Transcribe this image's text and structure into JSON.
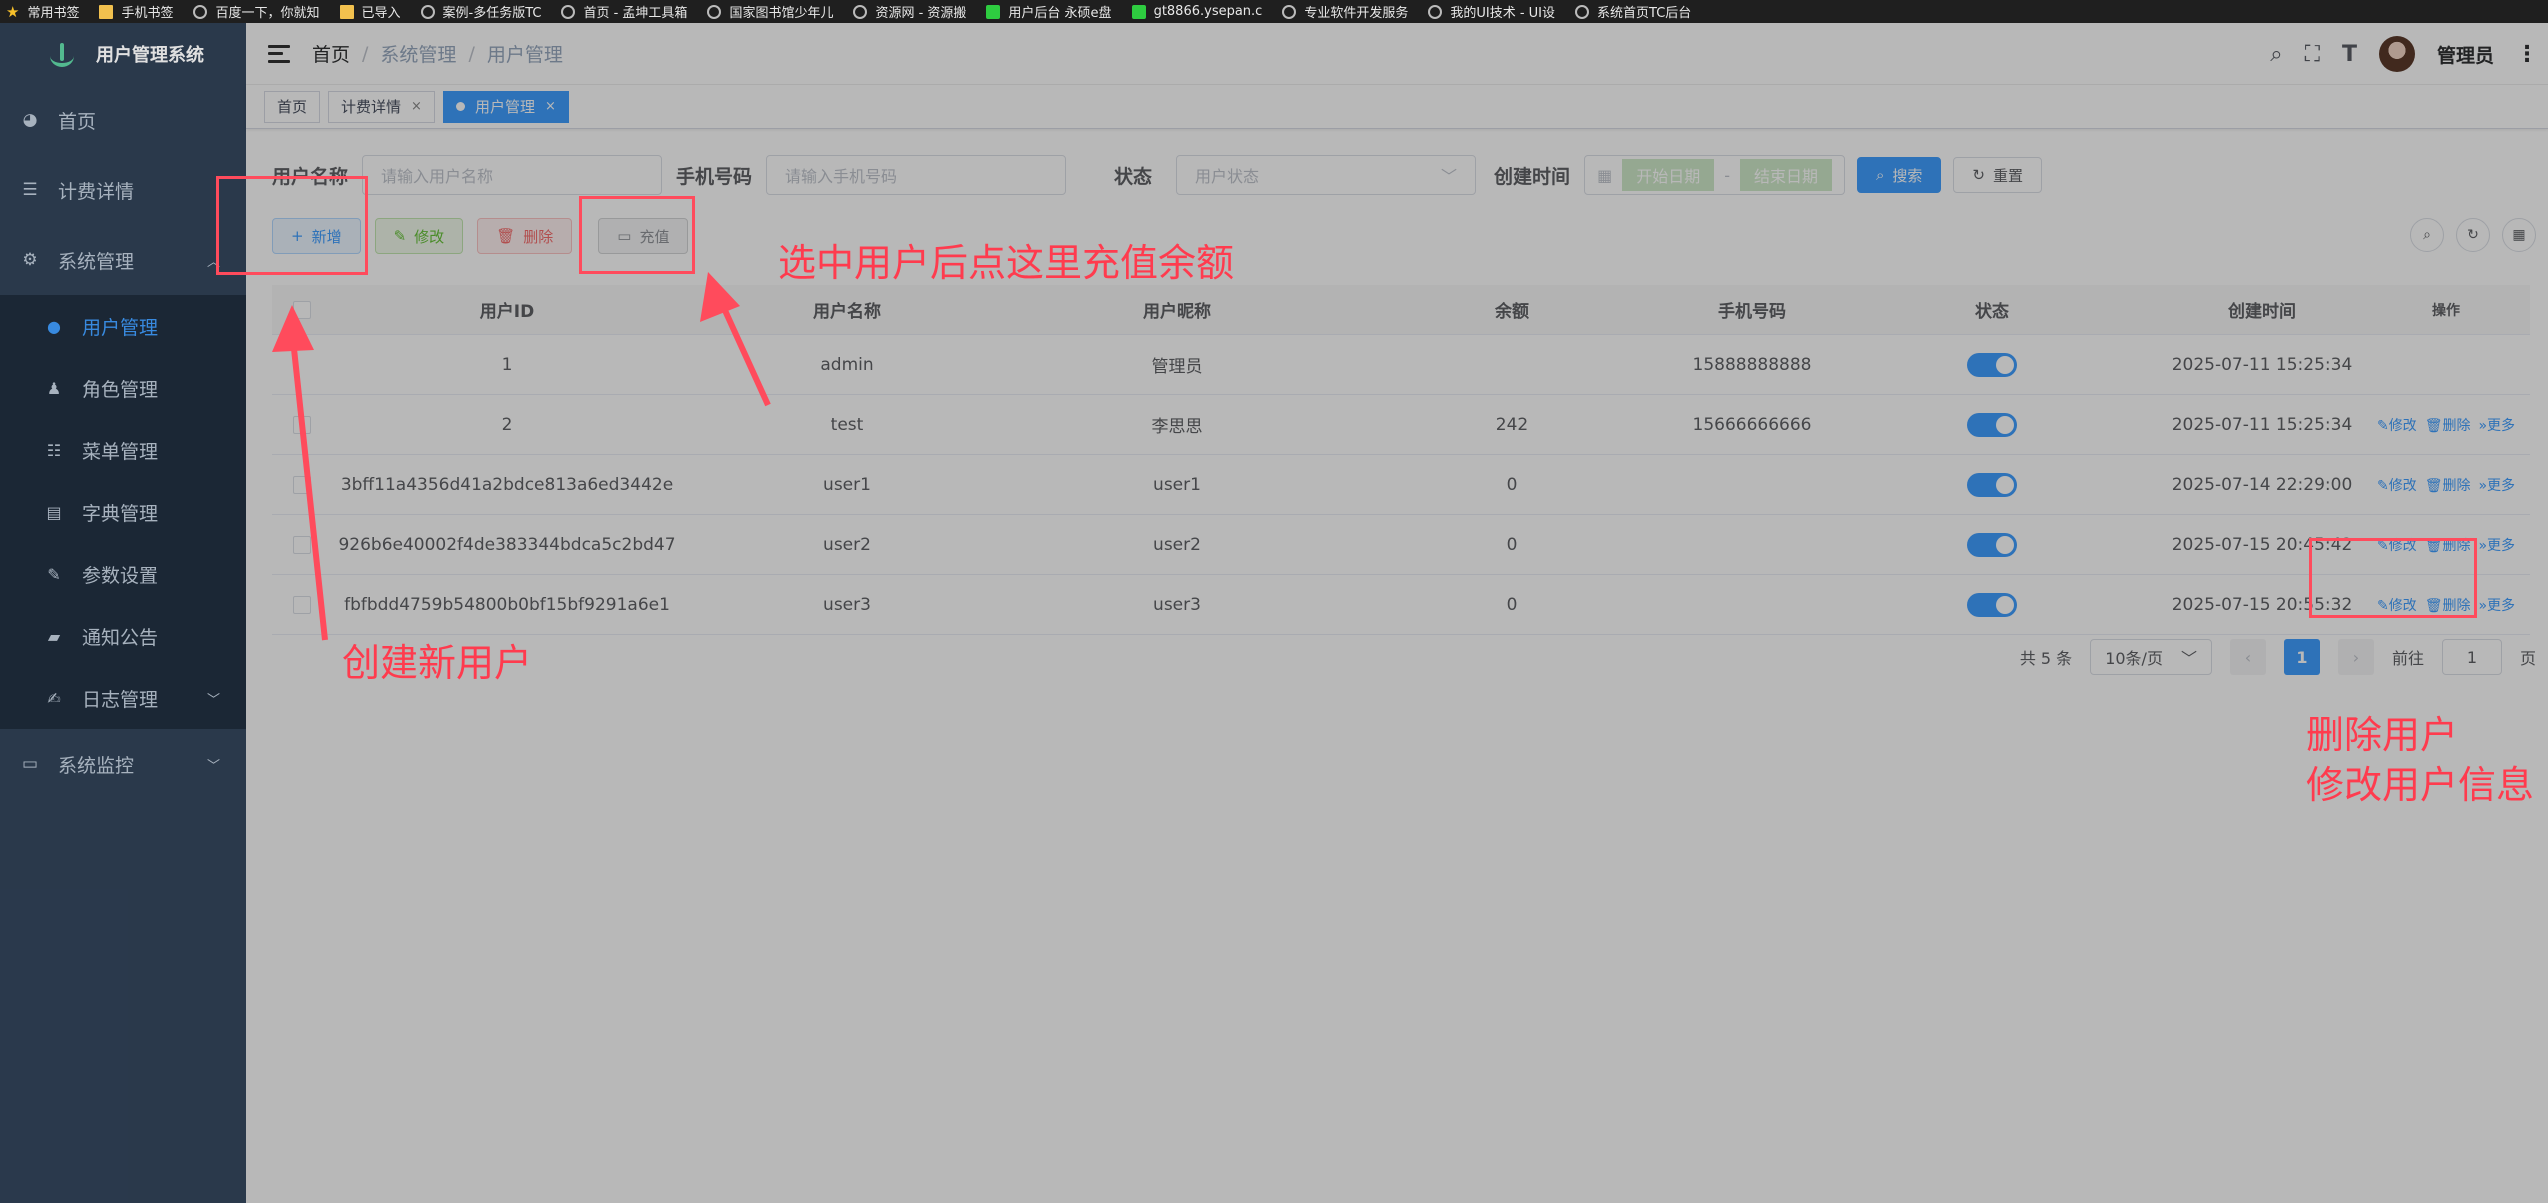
{
  "bookmarks": [
    "常用书签",
    "手机书签",
    "百度一下，你就知",
    "已导入",
    "案例-多任务版TC",
    "首页 - 孟坤工具箱",
    "国家图书馆少年儿",
    "资源网 - 资源搬",
    "用户后台 永硕e盘",
    "gt8866.ysepan.c",
    "专业软件开发服务",
    "我的UI技术 - UI设",
    "系统首页TC后台"
  ],
  "app_title": "用户管理系统",
  "sidebar": {
    "items": [
      {
        "label": "首页"
      },
      {
        "label": "计费详情"
      },
      {
        "label": "系统管理"
      },
      {
        "label": "系统监控"
      }
    ],
    "submenu": [
      {
        "label": "用户管理"
      },
      {
        "label": "角色管理"
      },
      {
        "label": "菜单管理"
      },
      {
        "label": "字典管理"
      },
      {
        "label": "参数设置"
      },
      {
        "label": "通知公告"
      },
      {
        "label": "日志管理"
      }
    ]
  },
  "breadcrumb": [
    "首页",
    "系统管理",
    "用户管理"
  ],
  "navbar": {
    "user_name": "管理员"
  },
  "tabs": [
    {
      "label": "首页"
    },
    {
      "label": "计费详情",
      "close": "×"
    },
    {
      "label": "用户管理",
      "close": "×"
    }
  ],
  "search": {
    "username_label": "用户名称",
    "username_placeholder": "请输入用户名称",
    "phone_label": "手机号码",
    "phone_placeholder": "请输入手机号码",
    "status_label": "状态",
    "status_placeholder": "用户状态",
    "created_label": "创建时间",
    "start_placeholder": "开始日期",
    "range_sep": "-",
    "end_placeholder": "结束日期",
    "search_btn": "搜索",
    "reset_btn": "重置"
  },
  "toolbar": {
    "add": "新增",
    "edit": "修改",
    "delete": "删除",
    "recharge": "充值"
  },
  "table": {
    "headers": [
      "用户ID",
      "用户名称",
      "用户昵称",
      "余额",
      "手机号码",
      "状态",
      "创建时间",
      "操作"
    ],
    "rows": [
      {
        "id": "1",
        "name": "admin",
        "nick": "管理员",
        "balance": "",
        "phone": "15888888888",
        "created": "2025-07-11 15:25:34",
        "ops": false
      },
      {
        "id": "2",
        "name": "test",
        "nick": "李思思",
        "balance": "242",
        "phone": "15666666666",
        "created": "2025-07-11 15:25:34",
        "ops": true
      },
      {
        "id": "3bff11a4356d41a2bdce813a6ed3442e",
        "name": "user1",
        "nick": "user1",
        "balance": "0",
        "phone": "",
        "created": "2025-07-14 22:29:00",
        "ops": true
      },
      {
        "id": "926b6e40002f4de383344bdca5c2bd47",
        "name": "user2",
        "nick": "user2",
        "balance": "0",
        "phone": "",
        "created": "2025-07-15 20:45:42",
        "ops": true
      },
      {
        "id": "fbfbdd4759b54800b0bf15bf9291a6e1",
        "name": "user3",
        "nick": "user3",
        "balance": "0",
        "phone": "",
        "created": "2025-07-15 20:55:32",
        "ops": true
      }
    ],
    "op_edit": "修改",
    "op_delete": "删除",
    "op_more": "更多"
  },
  "pagination": {
    "total": "共 5 条",
    "page_size": "10条/页",
    "current": "1",
    "goto_label": "前往",
    "goto_value": "1",
    "page_unit": "页"
  },
  "annotations": {
    "recharge_hint": "选中用户后点这里充值余额",
    "create_hint": "创建新用户",
    "delete_hint": "删除用户",
    "edit_hint": "修改用户信息"
  },
  "colors": {
    "sidebar_bg": "#304156",
    "primary": "#409eff",
    "annotation": "#ff4b5c"
  }
}
